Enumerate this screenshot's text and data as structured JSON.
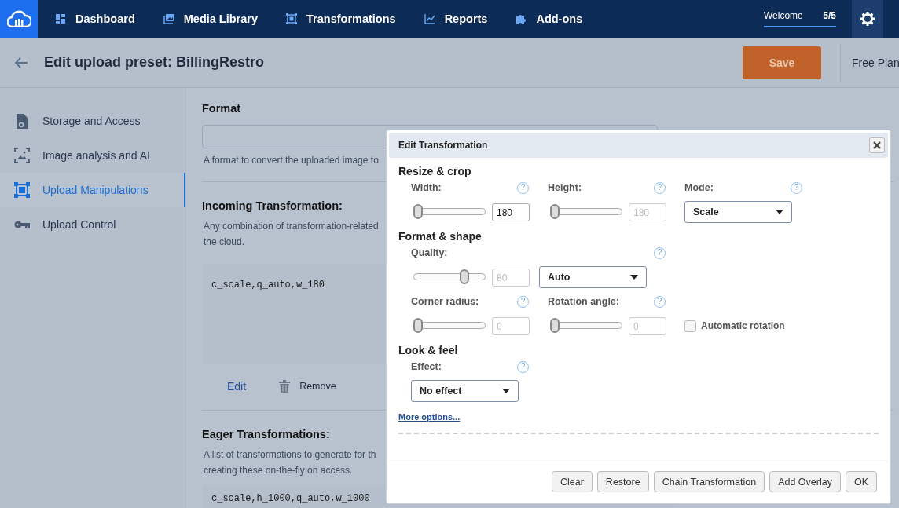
{
  "nav": {
    "items": [
      {
        "label": "Dashboard"
      },
      {
        "label": "Media Library"
      },
      {
        "label": "Transformations"
      },
      {
        "label": "Reports"
      },
      {
        "label": "Add-ons"
      }
    ],
    "welcome": {
      "label": "Welcome",
      "count": "5/5",
      "level": 1
    }
  },
  "header": {
    "title": "Edit upload preset: BillingRestro",
    "save": "Save",
    "plan": "Free Plan"
  },
  "sidebar": {
    "items": [
      {
        "label": "Storage and Access",
        "selected": false
      },
      {
        "label": "Image analysis and AI",
        "selected": false
      },
      {
        "label": "Upload Manipulations",
        "selected": true
      },
      {
        "label": "Upload Control",
        "selected": false
      }
    ]
  },
  "main": {
    "format": {
      "title": "Format",
      "hint": "A format to convert the uploaded image to"
    },
    "incoming": {
      "title": "Incoming Transformation:",
      "description": [
        "Any combination of transformation-related",
        "the cloud."
      ],
      "code": "c_scale,q_auto,w_180",
      "edit": "Edit",
      "remove": "Remove"
    },
    "eager": {
      "title": "Eager Transformations:",
      "description": [
        "A list of transformations to generate for th",
        "creating these on-the-fly on access."
      ],
      "code": "c_scale,h_1000,q_auto,w_1000"
    }
  },
  "dialog": {
    "title": "Edit Transformation",
    "sections": [
      {
        "title": "Resize & crop",
        "fields": [
          {
            "kind": "slider",
            "label": "Width:",
            "help": "?",
            "level": 0,
            "value": "180",
            "disabled": false
          },
          {
            "kind": "slider",
            "label": "Height:",
            "help": "?",
            "level": 0,
            "value": "180",
            "disabled": true
          },
          {
            "kind": "select",
            "label": "Mode:",
            "help": "?",
            "value": "Scale"
          }
        ]
      },
      {
        "title": "Format & shape",
        "fields": [
          {
            "kind": "slider_select",
            "label": "Quality:",
            "help": "?",
            "level": 0.75,
            "value": "80",
            "disabled": true,
            "option": "Auto"
          },
          {
            "kind": "slider",
            "label": "Corner radius:",
            "help": "?",
            "level": 0,
            "value": "0",
            "disabled": true
          },
          {
            "kind": "slider",
            "label": "Rotation angle:",
            "help": "?",
            "level": 0,
            "value": "0",
            "disabled": true
          },
          {
            "kind": "checkbox",
            "label": "Automatic rotation",
            "checked": false
          }
        ]
      },
      {
        "title": "Look & feel",
        "fields": [
          {
            "kind": "select",
            "label": "Effect:",
            "help": "?",
            "value": "No effect"
          }
        ]
      }
    ],
    "more": "More options...",
    "buttons": [
      "Clear",
      "Restore",
      "Chain Transformation",
      "Add Overlay",
      "OK"
    ]
  }
}
